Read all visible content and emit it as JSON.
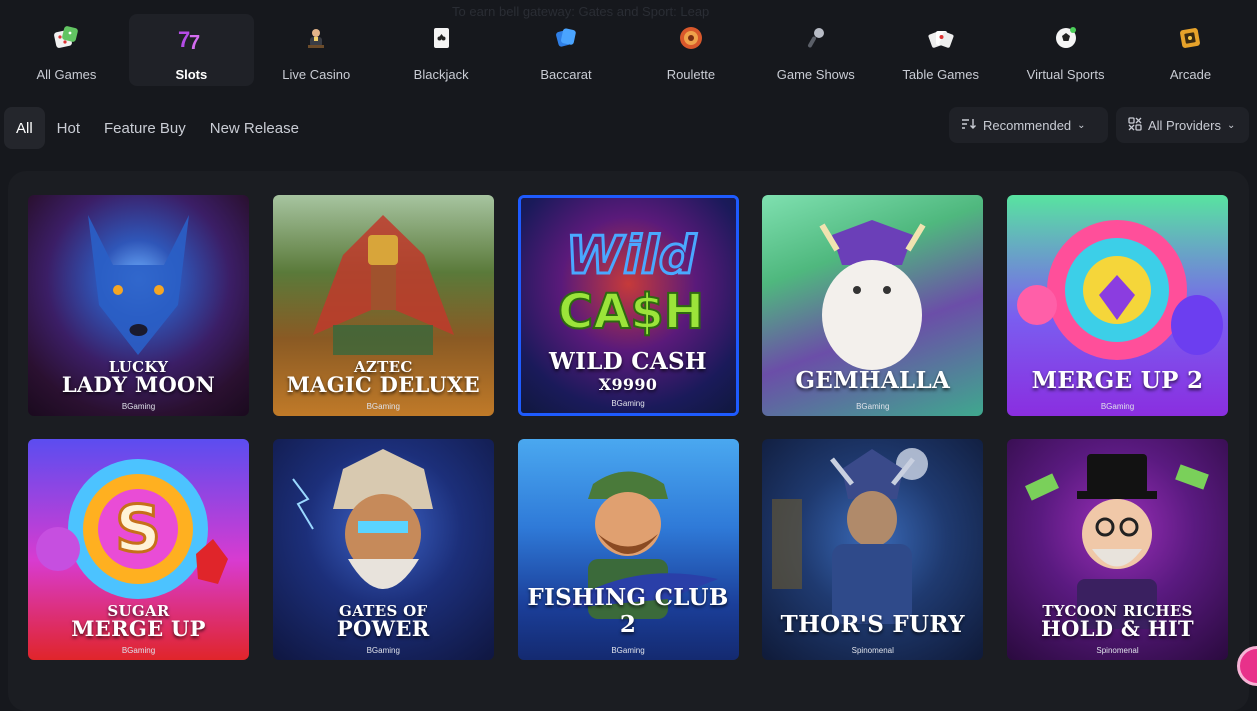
{
  "top_hint": "To earn bell gateway: Gates and Sport: Leap",
  "categories": [
    {
      "label": "All Games",
      "icon": "dice-icon"
    },
    {
      "label": "Slots",
      "icon": "slot-sevens-icon"
    },
    {
      "label": "Live Casino",
      "icon": "dealer-icon"
    },
    {
      "label": "Blackjack",
      "icon": "playing-card-icon"
    },
    {
      "label": "Baccarat",
      "icon": "baccarat-cards-icon"
    },
    {
      "label": "Roulette",
      "icon": "roulette-wheel-icon"
    },
    {
      "label": "Game Shows",
      "icon": "microphone-icon"
    },
    {
      "label": "Table Games",
      "icon": "card-fan-icon"
    },
    {
      "label": "Virtual Sports",
      "icon": "soccer-ball-icon"
    },
    {
      "label": "Arcade",
      "icon": "arcade-cube-icon"
    }
  ],
  "active_category": "Slots",
  "filters": [
    "All",
    "Hot",
    "Feature Buy",
    "New Release"
  ],
  "active_filter": "All",
  "sort": {
    "label": "Recommended",
    "icon": "sort-icon"
  },
  "providers": {
    "label": "All Providers",
    "icon": "providers-icon"
  },
  "games": [
    {
      "line1": "LUCKY",
      "line2": "LADY MOON",
      "provider": "BGaming"
    },
    {
      "line1": "AZTEC",
      "line2": "MAGIC DELUXE",
      "provider": "BGaming"
    },
    {
      "line1": "WILD CASH",
      "line2": "X9990",
      "provider": "BGaming"
    },
    {
      "line1": "",
      "line2": "GEMHALLA",
      "provider": "BGaming"
    },
    {
      "line1": "",
      "line2": "MERGE UP 2",
      "provider": "BGaming"
    },
    {
      "line1": "SUGAR",
      "line2": "MERGE UP",
      "provider": "BGaming"
    },
    {
      "line1": "GATES OF",
      "line2": "POWER",
      "provider": "BGaming"
    },
    {
      "line1": "",
      "line2": "FISHING CLUB 2",
      "provider": "BGaming"
    },
    {
      "line1": "",
      "line2": "THOR'S FURY",
      "provider": "Spinomenal"
    },
    {
      "line1": "TYCOON RICHES",
      "line2": "HOLD & HIT",
      "provider": "Spinomenal"
    }
  ],
  "colors": {
    "background": "#16181d",
    "panel": "#1b1d22",
    "active_tab": "#1f2127"
  }
}
